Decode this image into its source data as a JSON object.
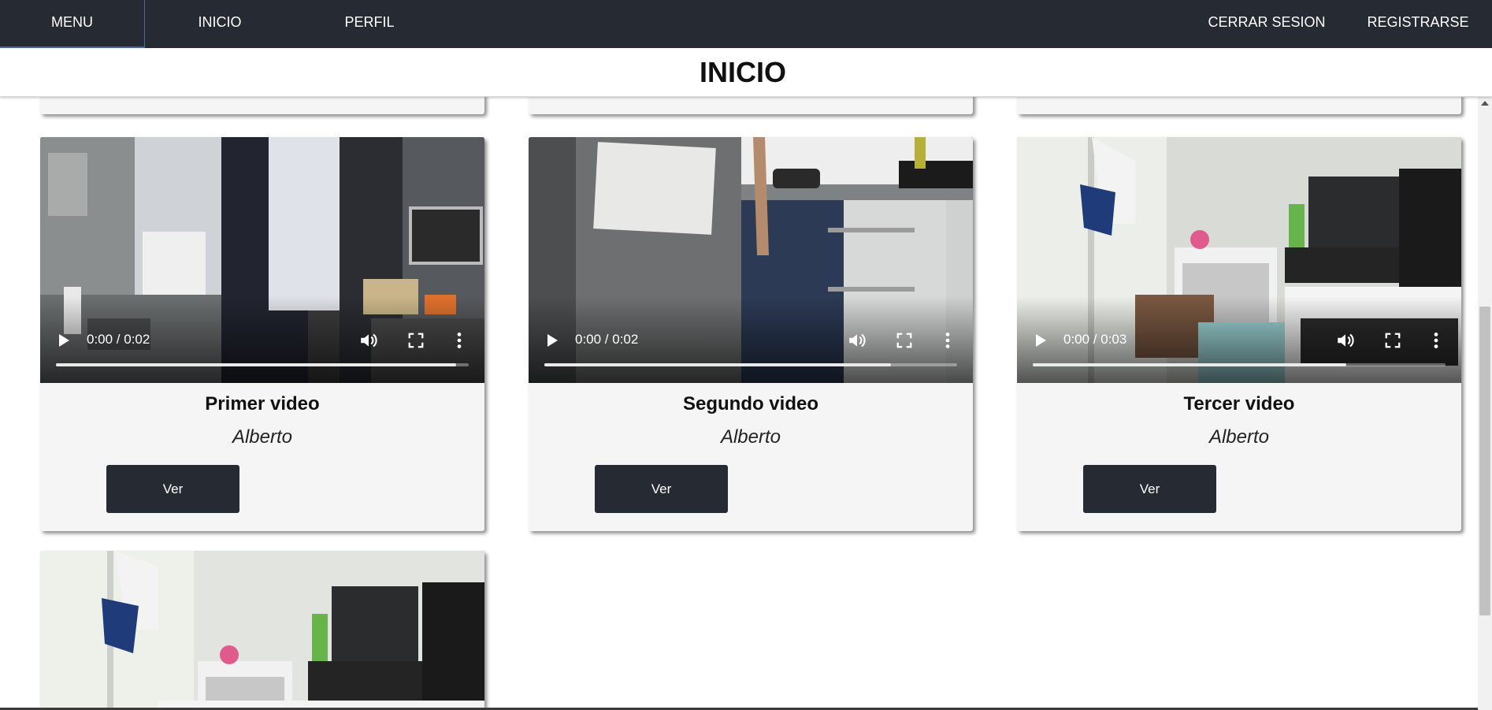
{
  "nav": {
    "menu": "MENU",
    "inicio": "INICIO",
    "perfil": "PERFIL",
    "logout": "CERRAR SESION",
    "register": "REGISTRARSE"
  },
  "page": {
    "title": "INICIO"
  },
  "videos": [
    {
      "title": "Primer video",
      "author": "Alberto",
      "time": "0:00 / 0:02",
      "button": "Ver",
      "progress": 0.97
    },
    {
      "title": "Segundo video",
      "author": "Alberto",
      "time": "0:00 / 0:02",
      "button": "Ver",
      "progress": 0.84
    },
    {
      "title": "Tercer video",
      "author": "Alberto",
      "time": "0:00 / 0:03",
      "button": "Ver",
      "progress": 0.76
    }
  ],
  "icons": {
    "play": "play-icon",
    "volume": "volume-icon",
    "fullscreen": "fullscreen-icon",
    "more": "more-options-icon"
  },
  "colors": {
    "navbar": "#262a33",
    "button": "#262a33",
    "card": "#f5f5f5",
    "menu_accent": "#4a66a8"
  }
}
